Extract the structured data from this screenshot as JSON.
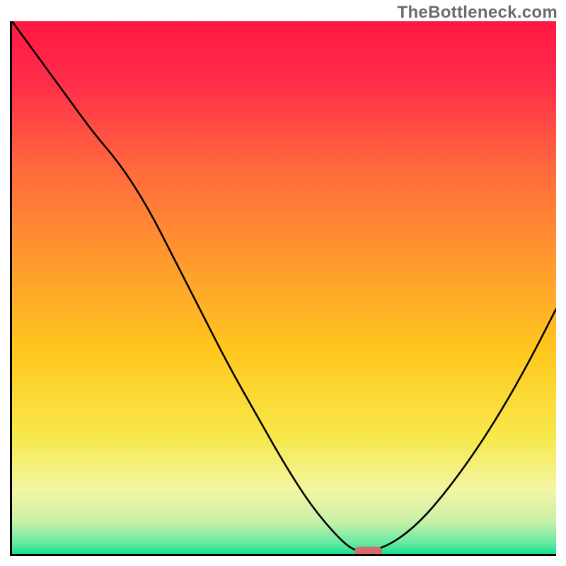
{
  "watermark": "TheBottleneck.com",
  "colors": {
    "gradient_stops": [
      {
        "offset": 0.0,
        "hex": "#ff1744"
      },
      {
        "offset": 0.12,
        "hex": "#ff2f4a"
      },
      {
        "offset": 0.28,
        "hex": "#ff6a3d"
      },
      {
        "offset": 0.45,
        "hex": "#ff9a2e"
      },
      {
        "offset": 0.62,
        "hex": "#ffc81e"
      },
      {
        "offset": 0.78,
        "hex": "#f7e84a"
      },
      {
        "offset": 0.88,
        "hex": "#f3f6a4"
      },
      {
        "offset": 0.94,
        "hex": "#c7f0a7"
      },
      {
        "offset": 0.98,
        "hex": "#66e9a3"
      },
      {
        "offset": 1.0,
        "hex": "#14e08d"
      }
    ],
    "curve_stroke": "#000000",
    "marker_fill": "#d46a6a",
    "axis_stroke": "#000000"
  },
  "chart_data": {
    "type": "line",
    "title": "",
    "xlabel": "",
    "ylabel": "",
    "xlim": [
      0,
      1
    ],
    "ylim": [
      0,
      1
    ],
    "grid": false,
    "legend": false,
    "x": [
      0.0,
      0.05,
      0.1,
      0.15,
      0.2,
      0.25,
      0.3,
      0.35,
      0.4,
      0.45,
      0.5,
      0.55,
      0.6,
      0.63,
      0.66,
      0.7,
      0.75,
      0.8,
      0.85,
      0.9,
      0.95,
      1.0
    ],
    "y": [
      1.0,
      0.93,
      0.86,
      0.79,
      0.73,
      0.65,
      0.55,
      0.45,
      0.35,
      0.26,
      0.17,
      0.09,
      0.03,
      0.005,
      0.005,
      0.02,
      0.06,
      0.12,
      0.19,
      0.27,
      0.36,
      0.46
    ],
    "marker": {
      "x_start": 0.63,
      "x_end": 0.68,
      "y": 0.005
    }
  }
}
